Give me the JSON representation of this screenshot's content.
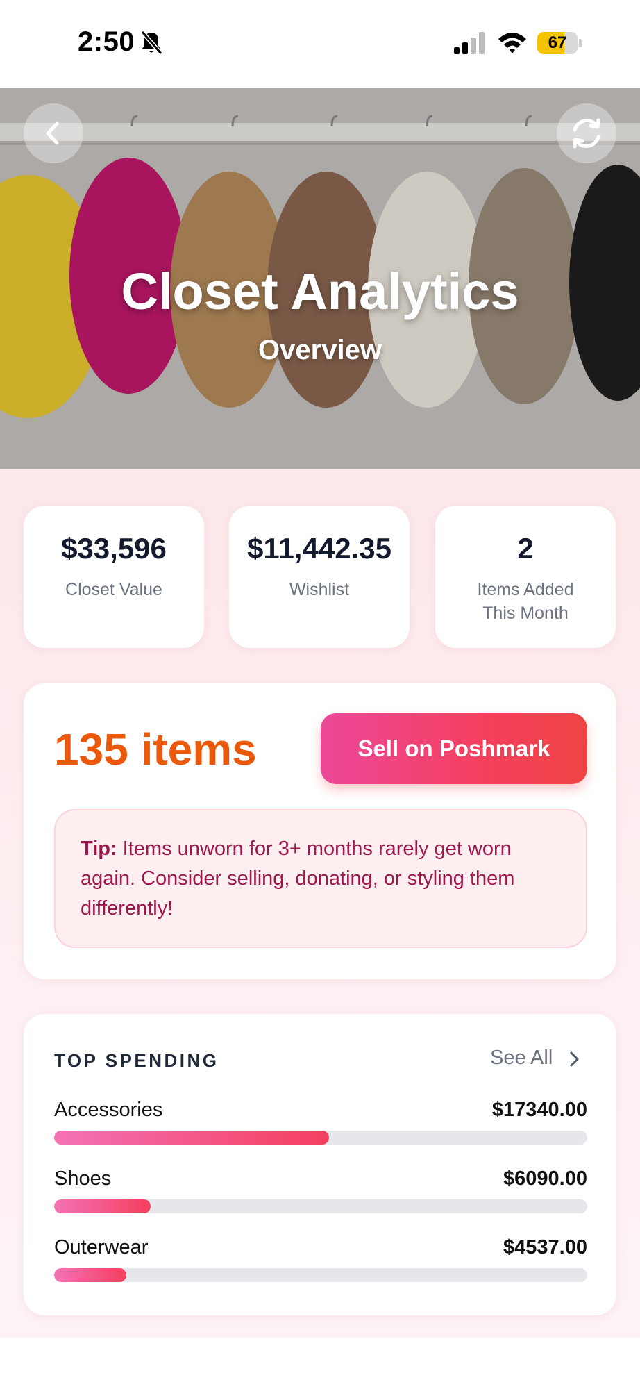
{
  "status_bar": {
    "time": "2:50",
    "battery": "67",
    "battery_level": 0.67
  },
  "hero": {
    "title": "Closet Analytics",
    "subtitle": "Overview"
  },
  "stats": [
    {
      "value": "$33,596",
      "label": "Closet Value"
    },
    {
      "value": "$11,442.35",
      "label": "Wishlist"
    },
    {
      "value": "2",
      "label": "Items Added This Month"
    }
  ],
  "summary": {
    "item_count": "135 items",
    "sell_button": "Sell on Poshmark",
    "tip_label": "Tip:",
    "tip_text": " Items unworn for 3+ months rarely get worn again. Consider selling, donating, or styling them differently!"
  },
  "top_spending": {
    "header": "TOP SPENDING",
    "see_all": "See All",
    "rows": [
      {
        "label": "Accessories",
        "amount": "$17340.00",
        "fill": 0.515
      },
      {
        "label": "Shoes",
        "amount": "$6090.00",
        "fill": 0.181
      },
      {
        "label": "Outerwear",
        "amount": "$4537.00",
        "fill": 0.135
      }
    ]
  },
  "colors": {
    "accent_orange": "#ea580c",
    "button_gradient_start": "#ec4899",
    "button_gradient_end": "#ef4444",
    "tip_text": "#9d174d",
    "bar_fill": "#f43f5e"
  },
  "icons": {
    "back": "chevron-left-icon",
    "refresh": "refresh-icon",
    "see_all": "chevron-right-icon",
    "mute": "bell-slash-icon",
    "signal": "cellular-signal-icon",
    "wifi": "wifi-icon",
    "battery": "battery-icon"
  }
}
